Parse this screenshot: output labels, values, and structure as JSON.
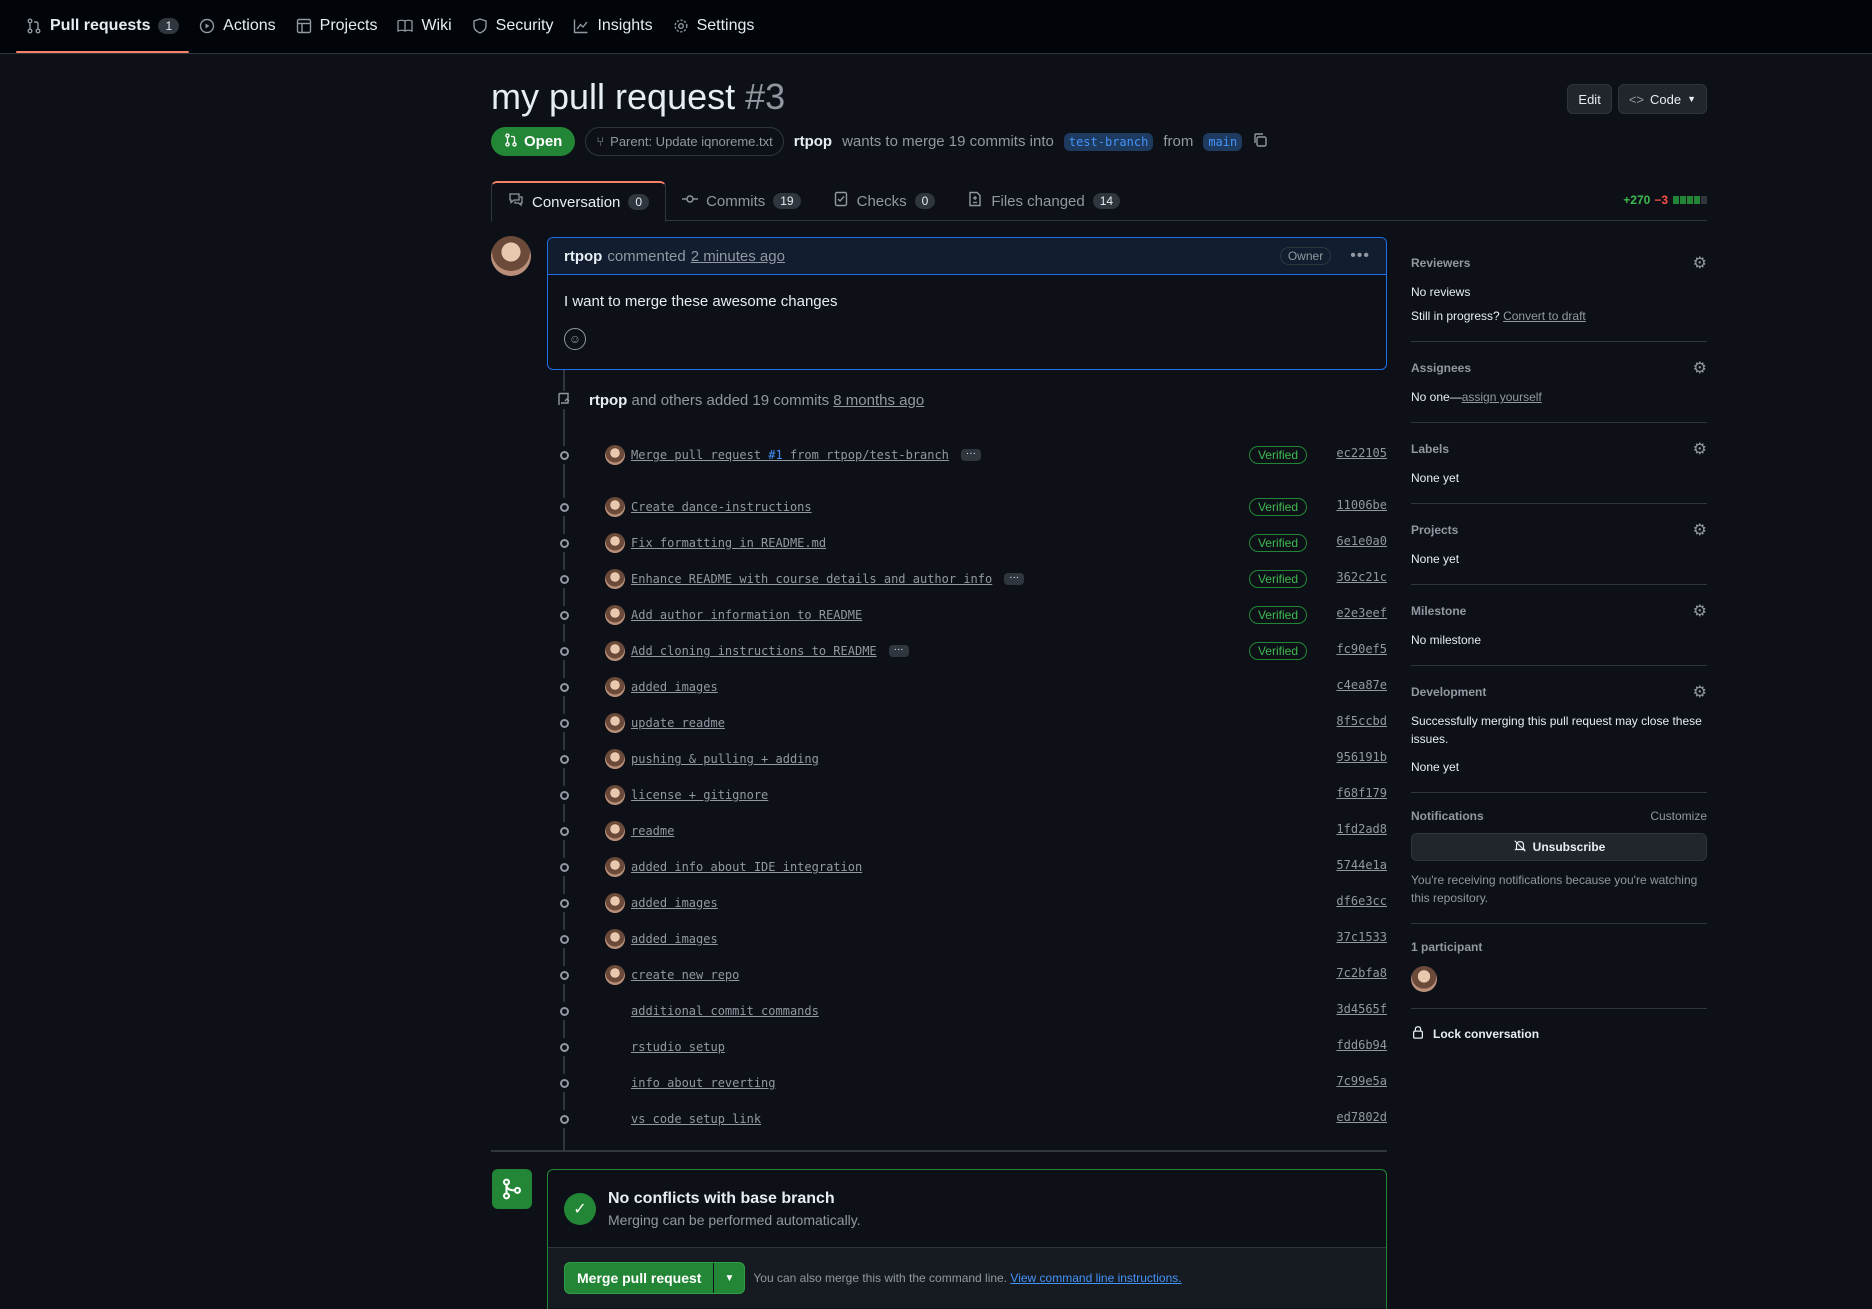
{
  "nav": {
    "items": [
      {
        "icon": "pull-request-icon",
        "label": "Pull requests",
        "count": "1",
        "active": true
      },
      {
        "icon": "actions-icon",
        "label": "Actions"
      },
      {
        "icon": "projects-icon",
        "label": "Projects"
      },
      {
        "icon": "wiki-icon",
        "label": "Wiki"
      },
      {
        "icon": "security-icon",
        "label": "Security"
      },
      {
        "icon": "insights-icon",
        "label": "Insights"
      },
      {
        "icon": "settings-icon",
        "label": "Settings"
      }
    ]
  },
  "header": {
    "title": "my pull request",
    "number": "#3",
    "edit_label": "Edit",
    "code_label": "Code",
    "state": "Open",
    "parent": "Parent: Update iqnoreme.txt",
    "author": "rtpop",
    "merge_text": "wants to merge 19 commits into",
    "base_branch": "test-branch",
    "from_text": "from",
    "head_branch": "main"
  },
  "tabs": [
    {
      "label": "Conversation",
      "count": "0",
      "icon": "conversation-icon"
    },
    {
      "label": "Commits",
      "count": "19",
      "icon": "commit-icon"
    },
    {
      "label": "Checks",
      "count": "0",
      "icon": "checks-icon"
    },
    {
      "label": "Files changed",
      "count": "14",
      "icon": "file-diff-icon"
    }
  ],
  "diffstat": {
    "additions": "+270",
    "deletions": "−3",
    "blocks": [
      "add",
      "add",
      "add",
      "add",
      "neutral"
    ]
  },
  "comment": {
    "author": "rtpop",
    "action": "commented",
    "time": "2 minutes ago",
    "badge": "Owner",
    "body": "I want to merge these awesome changes"
  },
  "push_event": {
    "author": "rtpop",
    "text": "and others added 19 commits",
    "time": "8 months ago"
  },
  "commits": [
    {
      "msg": "Merge pull request",
      "ref": "#1",
      "msg2": "from rtpop/test-branch",
      "ellipsis": true,
      "verified": true,
      "sha": "ec22105",
      "avatar": true
    },
    {
      "msg": "Create dance-instructions",
      "verified": true,
      "sha": "11006be",
      "avatar": true
    },
    {
      "msg": "Fix formatting in README.md",
      "verified": true,
      "sha": "6e1e0a0",
      "avatar": true
    },
    {
      "msg": "Enhance README with course details and author info",
      "ellipsis": true,
      "verified": true,
      "sha": "362c21c",
      "avatar": true
    },
    {
      "msg": "Add author information to README",
      "verified": true,
      "sha": "e2e3eef",
      "avatar": true
    },
    {
      "msg": "Add cloning instructions to README",
      "ellipsis": true,
      "verified": true,
      "sha": "fc90ef5",
      "avatar": true
    },
    {
      "msg": "added images",
      "sha": "c4ea87e",
      "avatar": true
    },
    {
      "msg": "update readme",
      "sha": "8f5ccbd",
      "avatar": true
    },
    {
      "msg": "pushing & pulling + adding",
      "sha": "956191b",
      "avatar": true
    },
    {
      "msg": "license + gitignore",
      "sha": "f68f179",
      "avatar": true
    },
    {
      "msg": "readme",
      "sha": "1fd2ad8",
      "avatar": true
    },
    {
      "msg": "added info about IDE integration",
      "sha": "5744e1a",
      "avatar": true
    },
    {
      "msg": "added images",
      "sha": "df6e3cc",
      "avatar": true
    },
    {
      "msg": "added images",
      "sha": "37c1533",
      "avatar": true
    },
    {
      "msg": "create new repo",
      "sha": "7c2bfa8",
      "avatar": true
    },
    {
      "msg": "additional commit commands",
      "sha": "3d4565f",
      "avatar": false
    },
    {
      "msg": "rstudio setup",
      "sha": "fdd6b94",
      "avatar": false
    },
    {
      "msg": "info about reverting",
      "sha": "7c99e5a",
      "avatar": false
    },
    {
      "msg": "vs code setup link",
      "sha": "ed7802d",
      "avatar": false
    }
  ],
  "verified_label": "Verified",
  "merge": {
    "title": "No conflicts with base branch",
    "subtitle": "Merging can be performed automatically.",
    "button": "Merge pull request",
    "hint": "You can also merge this with the command line.",
    "link": "View command line instructions."
  },
  "sidebar": {
    "reviewers": {
      "head": "Reviewers",
      "text": "No reviews",
      "progress": "Still in progress?",
      "draft_link": "Convert to draft"
    },
    "assignees": {
      "head": "Assignees",
      "text": "No one—",
      "link": "assign yourself"
    },
    "labels": {
      "head": "Labels",
      "text": "None yet"
    },
    "projects": {
      "head": "Projects",
      "text": "None yet"
    },
    "milestone": {
      "head": "Milestone",
      "text": "No milestone"
    },
    "development": {
      "head": "Development",
      "text": "Successfully merging this pull request may close these issues.",
      "none": "None yet"
    },
    "notifications": {
      "head": "Notifications",
      "customize": "Customize",
      "button": "Unsubscribe",
      "note": "You're receiving notifications because you're watching this repository."
    },
    "participants": {
      "head": "1 participant"
    },
    "lock": "Lock conversation"
  },
  "colors": {
    "accent": "#f78166",
    "green": "#238636",
    "blue": "#4493f8",
    "bg": "#0d1117"
  }
}
